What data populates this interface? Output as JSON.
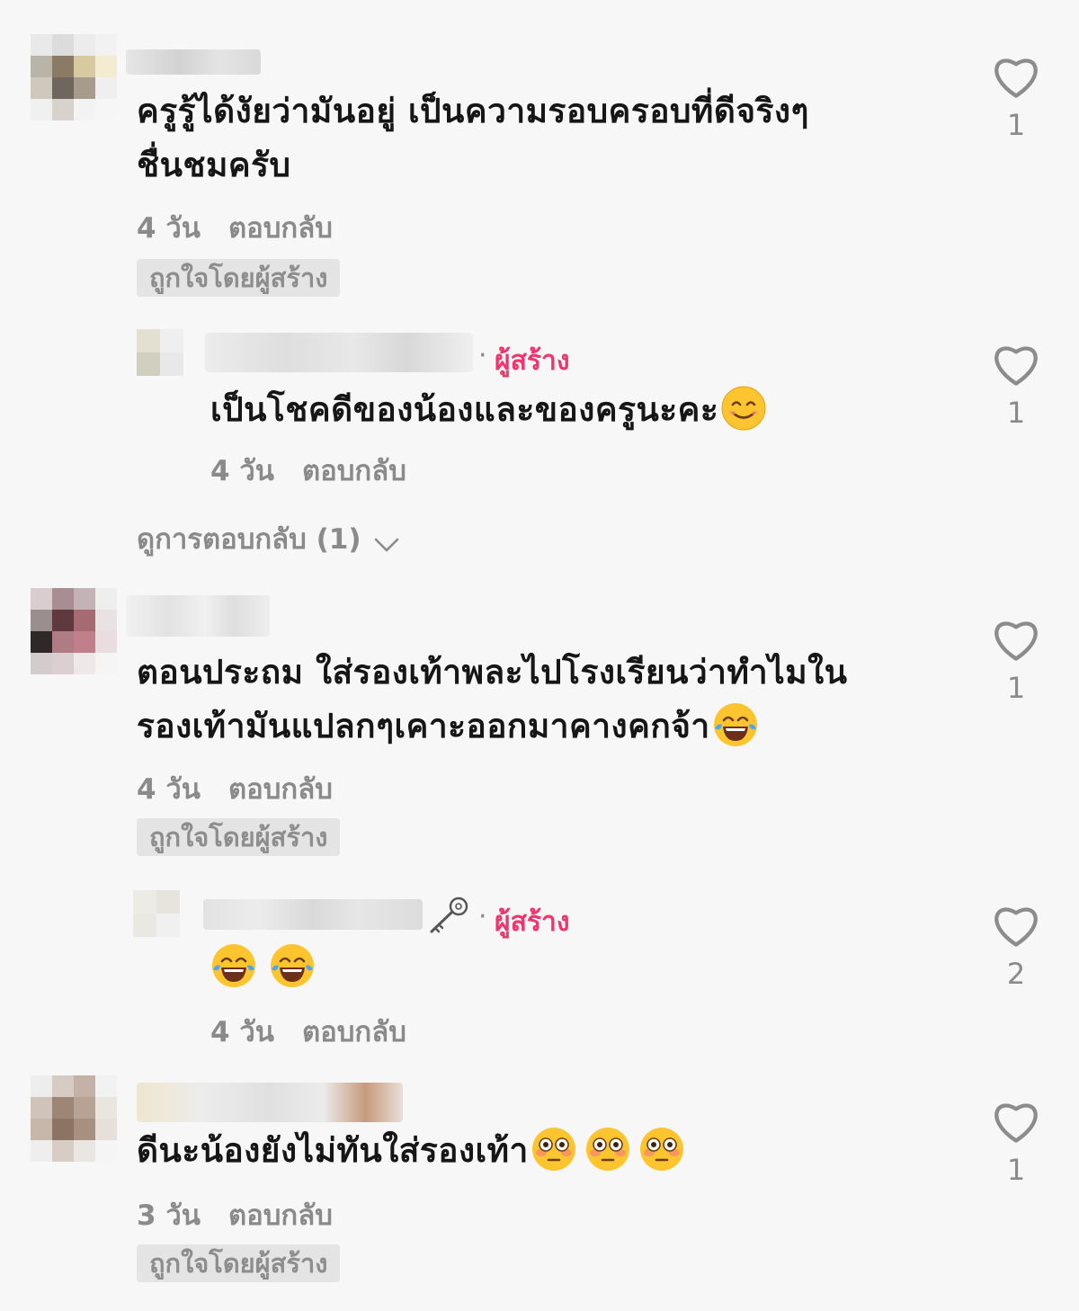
{
  "comments": [
    {
      "text_lines": [
        "ครูรู้ได้งัยว่ามันอยู่ เป็นความรอบครอบที่ดีจริงๆ",
        "ชื่นชมครับ"
      ],
      "time": "4 วัน",
      "reply_label": "ตอบกลับ",
      "liked_badge": "ถูกใจโดยผู้สร้าง",
      "likes": "1"
    },
    {
      "text_lines": [
        "ตอนประถม ใส่รองเท้าพละไปโรงเรียนว่าทำไมใน",
        "รองเท้ามันแปลกๆเคาะออกมาคางคกจ้า"
      ],
      "time": "4 วัน",
      "reply_label": "ตอบกลับ",
      "liked_badge": "ถูกใจโดยผู้สร้าง",
      "likes": "1"
    },
    {
      "text_lines": [
        "ดีนะน้องยังไม่ทันใส่รองเท้า"
      ],
      "time": "3 วัน",
      "reply_label": "ตอบกลับ",
      "liked_badge": "ถูกใจโดยผู้สร้าง",
      "likes": "1"
    }
  ],
  "replies": [
    {
      "creator_label": "ผู้สร้าง",
      "text": "เป็นโชคดีของน้องและของครูนะคะ",
      "time": "4 วัน",
      "reply_label": "ตอบกลับ",
      "likes": "1"
    },
    {
      "creator_label": "ผู้สร้าง",
      "text": "",
      "time": "4 วัน",
      "reply_label": "ตอบกลับ",
      "likes": "2"
    }
  ],
  "view_replies": "ดูการตอบกลับ (1)",
  "colors": {
    "creator": "#f0346e",
    "muted": "#8a8a8a",
    "text": "#161616",
    "badge_bg": "#e4e4e4"
  },
  "icons": [
    "heart-outline-icon",
    "chevron-down-icon",
    "key-icon",
    "smiling-face-emoji",
    "tears-of-joy-emoji",
    "flushed-face-emoji"
  ]
}
